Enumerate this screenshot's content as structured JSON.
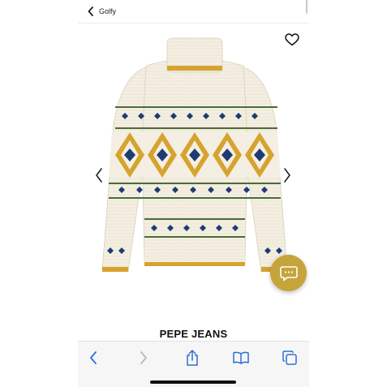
{
  "nav": {
    "back_label": "Golfy",
    "back_icon": "chevron-left-icon"
  },
  "product": {
    "brand": "PEPE JEANS"
  },
  "colors": {
    "accent_gold": "#c5a43c",
    "ios_blue": "#2f6fd6"
  },
  "icons": {
    "favorite": "heart-outline-icon",
    "prev_image": "chevron-left-icon",
    "next_image": "chevron-right-icon",
    "chat": "chat-bubble-icon"
  },
  "browser_toolbar": [
    "back",
    "forward",
    "share",
    "bookmarks",
    "tabs"
  ]
}
